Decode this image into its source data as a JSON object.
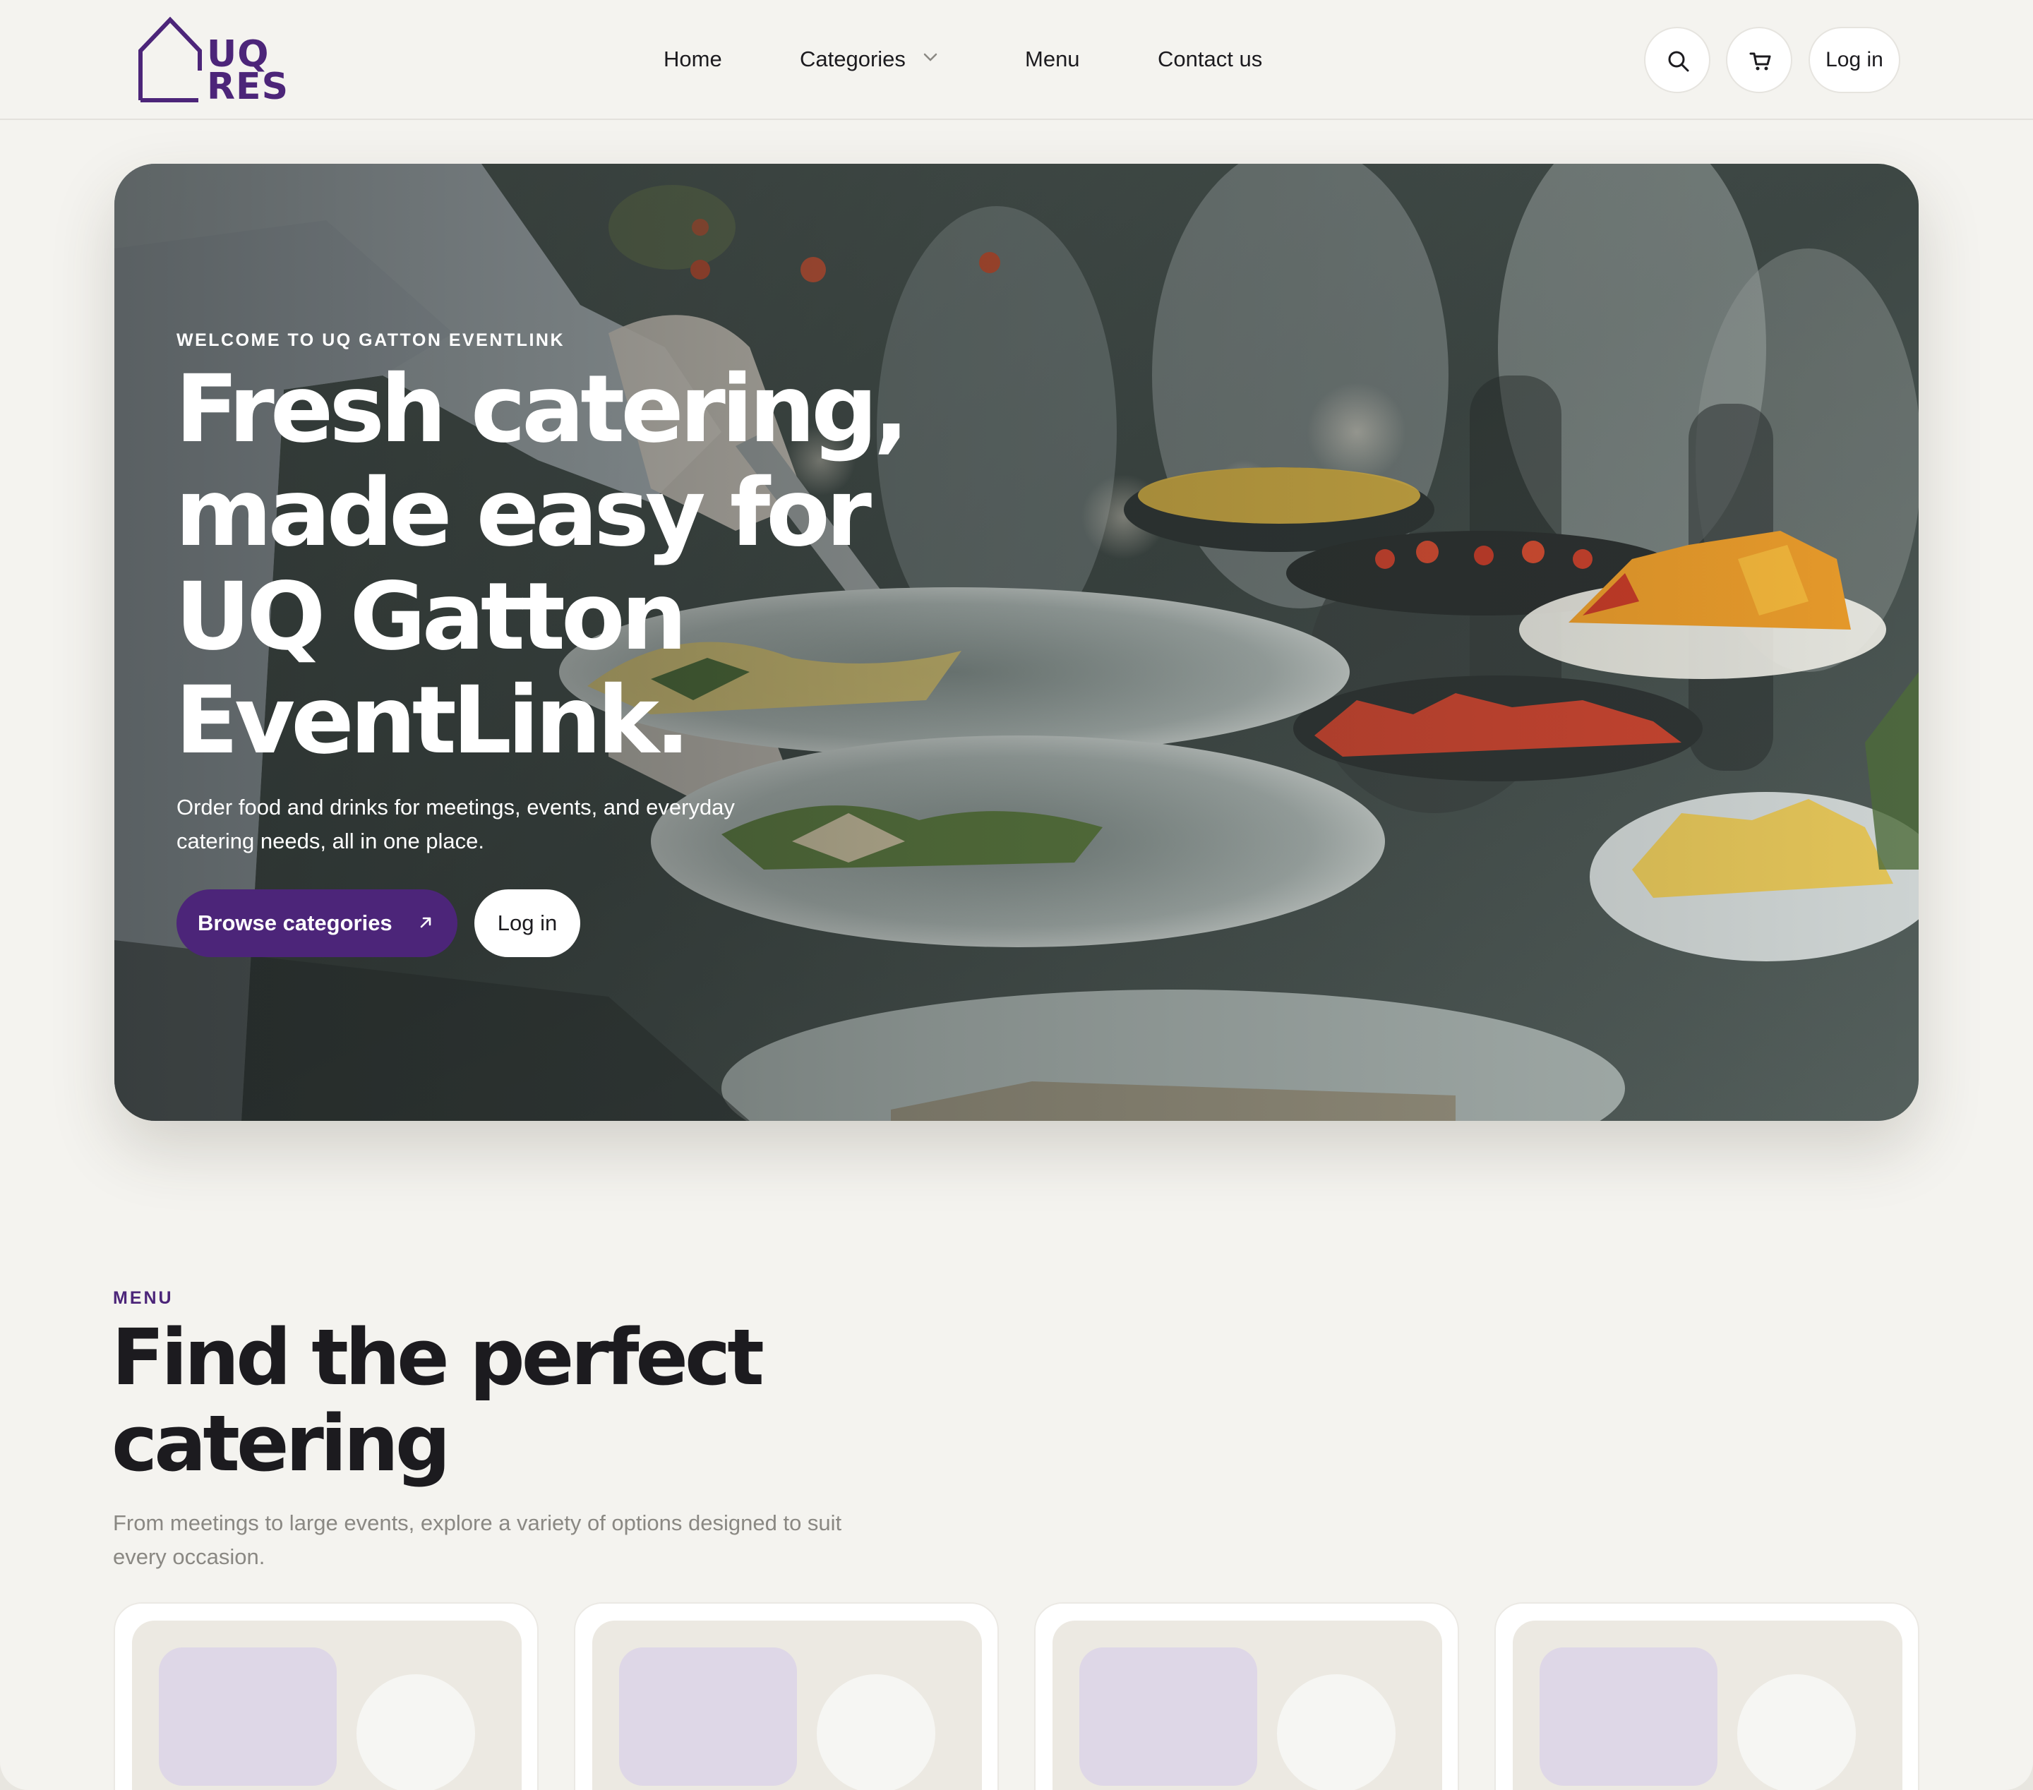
{
  "brand": {
    "logo_text_line1": "UQ",
    "logo_text_line2": "RES",
    "accent_color": "#4c2579"
  },
  "nav": {
    "home": "Home",
    "categories": "Categories",
    "menu": "Menu",
    "contact": "Contact us",
    "login": "Log in",
    "icons": [
      "search-icon",
      "cart-icon",
      "chevron-down-icon"
    ]
  },
  "hero": {
    "eyebrow": "WELCOME TO UQ GATTON EVENTLINK",
    "title_line1": "Fresh catering,",
    "title_line2": "made easy for",
    "title_line3": "UQ Gatton",
    "title_line4": "EventLink.",
    "subtitle": "Order food and drinks for meetings, events, and everyday catering needs, all in one place.",
    "browse_button": "Browse categories",
    "login_button": "Log in"
  },
  "menu_section": {
    "eyebrow": "MENU",
    "title_line1": "Find the perfect",
    "title_line2": "catering",
    "subtitle": "From meetings to large events, explore a variety of options designed to suit every occasion."
  }
}
